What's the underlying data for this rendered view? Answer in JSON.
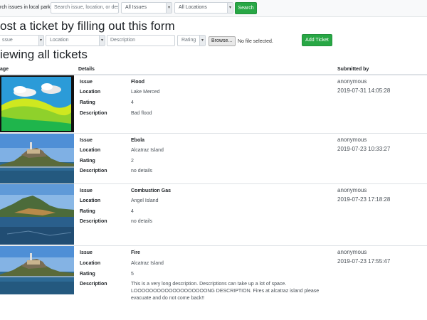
{
  "topbar": {
    "label": "rch issues in local parks",
    "search_placeholder": "Search issue, location, or des",
    "issue_filter": "All Issues",
    "location_filter": "All Locations",
    "search_button": "Search"
  },
  "form": {
    "heading": "ost a ticket by filling out this form",
    "issue_placeholder": "ssue",
    "location_placeholder": "Location",
    "description_placeholder": "Description",
    "rating_placeholder": "Rating",
    "browse_label": "Browse...",
    "file_status": "No file selected.",
    "add_button": "Add Ticket"
  },
  "tickets_section": {
    "heading": "iewing all tickets",
    "col_image": "age",
    "col_details": "Details",
    "col_submitted": "Submitted by"
  },
  "field_labels": {
    "issue": "Issue",
    "location": "Location",
    "rating": "Rating",
    "description": "Description"
  },
  "tickets": [
    {
      "issue": "Flood",
      "location": "Lake Merced",
      "rating": "4",
      "description": "Bad flood",
      "user": "anonymous",
      "date": "2019-07-31 14:05:28"
    },
    {
      "issue": "Ebola",
      "location": "Alcatraz Island",
      "rating": "2",
      "description": "no details",
      "user": "anonymous",
      "date": "2019-07-23 10:33:27"
    },
    {
      "issue": "Combustion Gas",
      "location": "Angel Island",
      "rating": "4",
      "description": "no details",
      "user": "anonymous",
      "date": "2019-07-23 17:18:28"
    },
    {
      "issue": "Fire",
      "location": "Alcatraz Island",
      "rating": "5",
      "description": "This is a very long description. Descriptions can take up a lot of space. LOOOOOOOOOOOOOOOOOOONG DESCRIPTION. Fires at alcatraz island please evacuate and do not come back!!",
      "user": "anonymous",
      "date": "2019-07-23 17:55:47"
    }
  ],
  "colors": {
    "accent_green": "#28a745",
    "flood_grass": "#8fd12b",
    "flood_sky": "#2b9bd8"
  }
}
